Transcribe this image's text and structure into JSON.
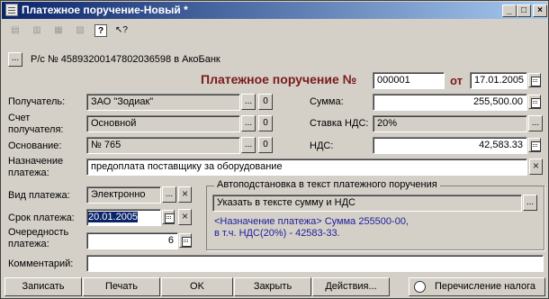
{
  "window": {
    "title": "Платежное поручение-Новый *",
    "controls": [
      "_",
      "□",
      "×"
    ]
  },
  "toolbar": {
    "icons": [
      "document-icon",
      "document-delete-icon",
      "document-list-icon",
      "document-tree-icon",
      "help-icon",
      "context-help-icon"
    ]
  },
  "account": {
    "text": "Р/с № 45893200147802036598 в АкоБанк"
  },
  "document": {
    "title": "Платежное поручение №",
    "number": "000001",
    "date_label": "от",
    "date": "17.01.2005"
  },
  "left": {
    "recipient_label": "Получатель:",
    "recipient_value": "ЗАО \"Зодиак\"",
    "recipient_account_label_1": "Счет",
    "recipient_account_label_2": "получателя:",
    "recipient_account_value": "Основной",
    "basis_label": "Основание:",
    "basis_value": "№ 765",
    "zero_btn": "0"
  },
  "right": {
    "sum_label": "Сумма:",
    "sum_value": "255,500.00",
    "vat_rate_label": "Ставка НДС:",
    "vat_rate_value": "20%",
    "vat_label": "НДС:",
    "vat_value": "42,583.33"
  },
  "purpose": {
    "label_1": "Назначение",
    "label_2": "платежа:",
    "value": "предоплата поставщику за оборудование"
  },
  "payment": {
    "type_label": "Вид платежа:",
    "type_value": "Электронно",
    "deadline_label": "Срок платежа:",
    "deadline_value": "20.01.2005",
    "priority_label_1": "Очередность",
    "priority_label_2": "платежа:",
    "priority_value": "6"
  },
  "autofill": {
    "title": "Автоподстановка в текст платежного поручения",
    "option": "Указать в тексте сумму и НДС",
    "note_1": "<Назначение платежа> Сумма 255500-00,",
    "note_2": "в т.ч. НДС(20%) - 42583-33."
  },
  "comment": {
    "label": "Комментарий:",
    "value": ""
  },
  "buttons": {
    "record": "Записать",
    "print": "Печать",
    "ok": "OK",
    "close": "Закрыть",
    "actions": "Действия...",
    "tax": "Перечисление налога"
  },
  "common": {
    "ellipsis": "...",
    "x": "×"
  }
}
